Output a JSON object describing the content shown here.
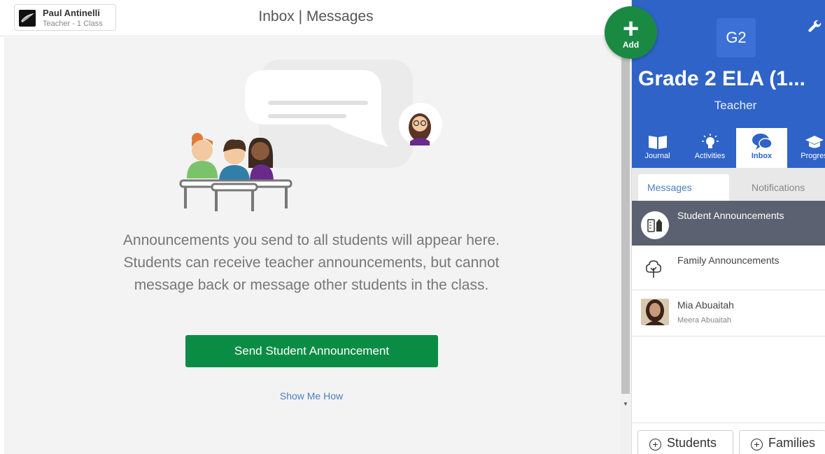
{
  "header": {
    "user_name": "Paul Antinelli",
    "user_role": "Teacher - 1 Class",
    "title": "Inbox | Messages"
  },
  "main": {
    "description": "Announcements you send to all students will appear here. Students can receive teacher announcements, but cannot message back or message other students in the class.",
    "send_button": "Send Student Announcement",
    "show_me_how": "Show Me How"
  },
  "fab": {
    "label": "Add",
    "icon": "plus-icon"
  },
  "class": {
    "badge": "G2",
    "name": "Grade 2 ELA (1...",
    "role": "Teacher"
  },
  "nav": {
    "items": [
      {
        "label": "Journal",
        "icon": "book-icon"
      },
      {
        "label": "Activities",
        "icon": "lightbulb-icon"
      },
      {
        "label": "Inbox",
        "icon": "chat-icon"
      },
      {
        "label": "Progres",
        "icon": "graduation-cap-icon"
      }
    ]
  },
  "tabs": {
    "messages": "Messages",
    "notifications": "Notifications"
  },
  "conversations": [
    {
      "title": "Student Announcements",
      "sub": ""
    },
    {
      "title": "Family Announcements",
      "sub": ""
    },
    {
      "title": "Mia Abuaitah",
      "sub": "Meera Abuaitah"
    }
  ],
  "bottom": {
    "students": "Students",
    "families": "Families"
  }
}
